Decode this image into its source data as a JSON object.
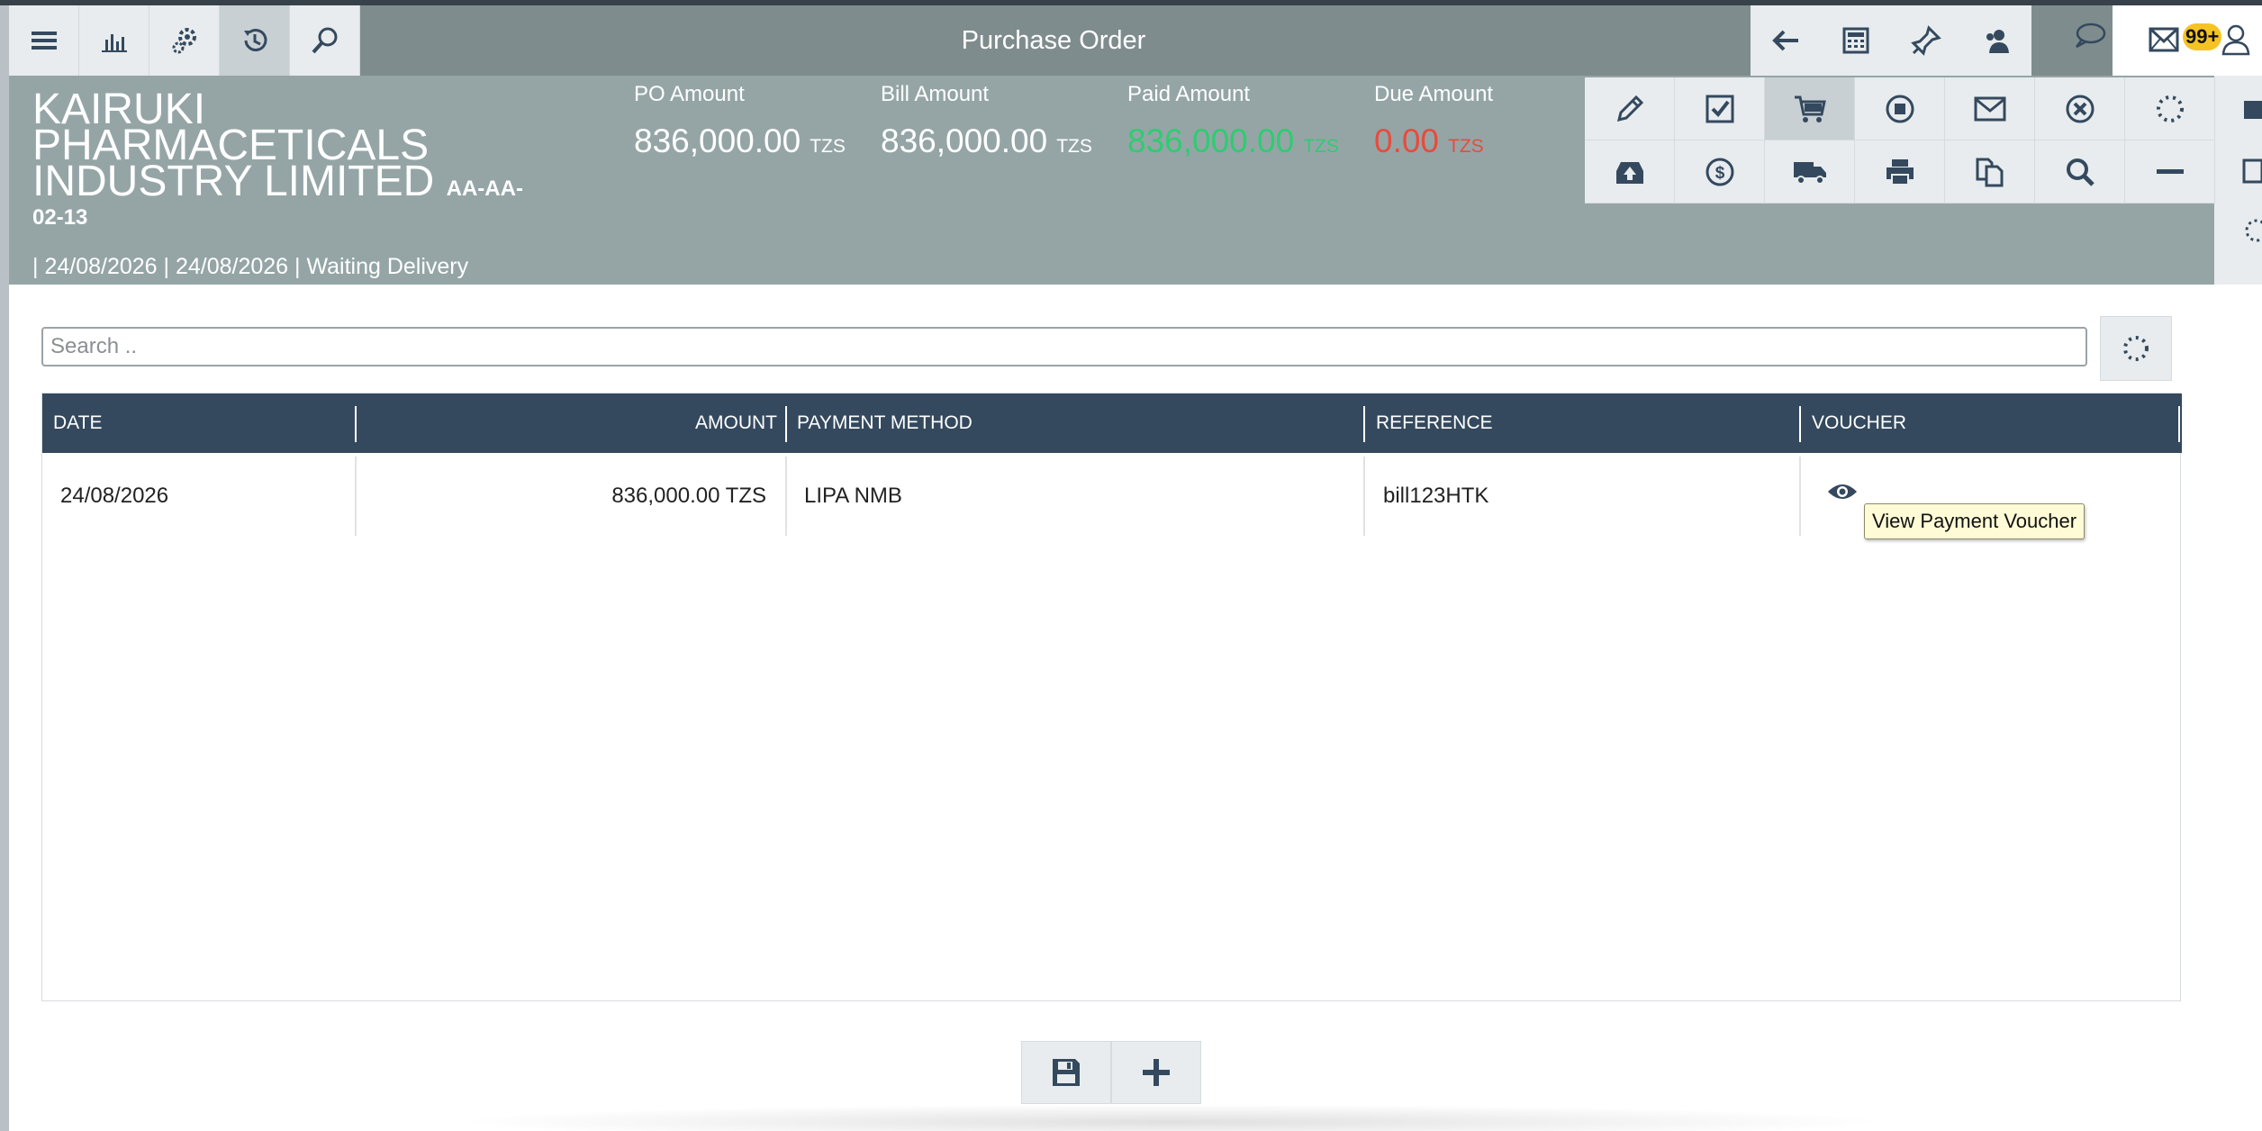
{
  "toolbar": {
    "title": "Purchase Order",
    "left_icons": [
      "menu-icon",
      "chart-icon",
      "settings-icon",
      "history-icon",
      "search-icon"
    ],
    "right_icons": [
      "back-arrow-icon",
      "calculator-icon",
      "pin-icon",
      "contacts-icon",
      "chat-icon",
      "mail-icon",
      "user-icon"
    ],
    "notification_badge": "99+"
  },
  "header": {
    "company_name": "KAIRUKI PHARMACETICALS INDUSTRY LIMITED",
    "code_part1": "AA-AA-",
    "code_part2": "02-13",
    "subline": "| 24/08/2026 | 24/08/2026 | Waiting Delivery",
    "amounts": {
      "po": {
        "label": "PO Amount",
        "value": "836,000.00",
        "currency": "TZS"
      },
      "bill": {
        "label": "Bill Amount",
        "value": "836,000.00",
        "currency": "TZS"
      },
      "paid": {
        "label": "Paid Amount",
        "value": "836,000.00",
        "currency": "TZS"
      },
      "due": {
        "label": "Due Amount",
        "value": "0.00",
        "currency": "TZS"
      }
    },
    "colors": {
      "paid": "#2ecc71",
      "due": "#e74c3c",
      "header_bg": "#95a5a6",
      "toolbar_bg": "#7f8c8d"
    }
  },
  "actions": {
    "row1": [
      "edit-icon",
      "approve-icon",
      "cart-icon",
      "stop-icon",
      "email-icon",
      "cancel-icon",
      "loading-icon"
    ],
    "row2": [
      "archive-icon",
      "payment-icon",
      "delivery-truck-icon",
      "print-icon",
      "copy-icon",
      "zoom-icon",
      "minus-icon"
    ]
  },
  "search": {
    "placeholder": "Search .."
  },
  "table": {
    "headers": {
      "date": "DATE",
      "amount": "AMOUNT",
      "method": "PAYMENT METHOD",
      "reference": "REFERENCE",
      "voucher": "VOUCHER"
    },
    "rows": [
      {
        "date": "24/08/2026",
        "amount": "836,000.00 TZS",
        "method": "LIPA NMB",
        "reference": "bill123HTK"
      }
    ],
    "header_bg": "#34495e"
  },
  "tooltip": "View Payment Voucher",
  "bottom": {
    "icons": [
      "save-icon",
      "add-icon"
    ]
  }
}
